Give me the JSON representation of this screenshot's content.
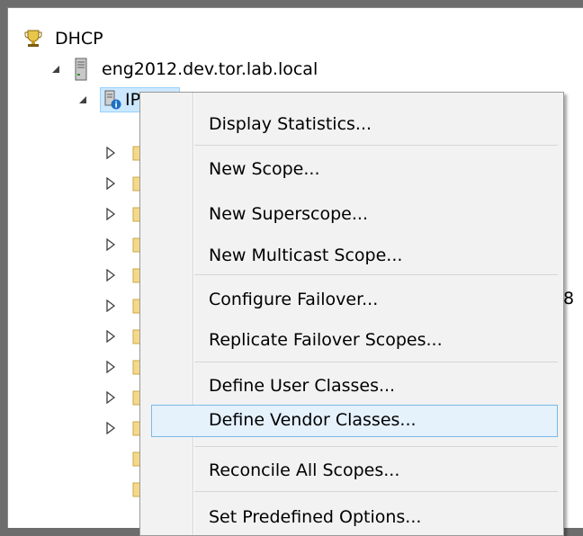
{
  "tree": {
    "root": {
      "label": "DHCP",
      "icon": "dhcp-trophy-icon"
    },
    "server": {
      "label": "eng2012.dev.tor.lab.local",
      "icon": "server-icon",
      "expanded": true
    },
    "ipv4": {
      "label": "IPv4",
      "icon": "ipv4-icon",
      "expanded": true
    },
    "hidden_child_count": 12,
    "partial_text": "8"
  },
  "context_menu": {
    "items": [
      {
        "label": "Display Statistics..."
      },
      {
        "label": "New Scope..."
      },
      {
        "label": "New Superscope..."
      },
      {
        "label": "New Multicast Scope..."
      },
      {
        "label": "Configure Failover..."
      },
      {
        "label": "Replicate Failover Scopes..."
      },
      {
        "label": "Define User Classes..."
      },
      {
        "label": "Define Vendor Classes...",
        "highlighted": true
      },
      {
        "label": "Reconcile All Scopes..."
      },
      {
        "label": "Set Predefined Options..."
      }
    ]
  },
  "colors": {
    "highlight_bg": "#e5f1fb",
    "highlight_border": "#7ab9e6",
    "menu_bg": "#f2f2f2",
    "folder": "#f5d98a"
  }
}
